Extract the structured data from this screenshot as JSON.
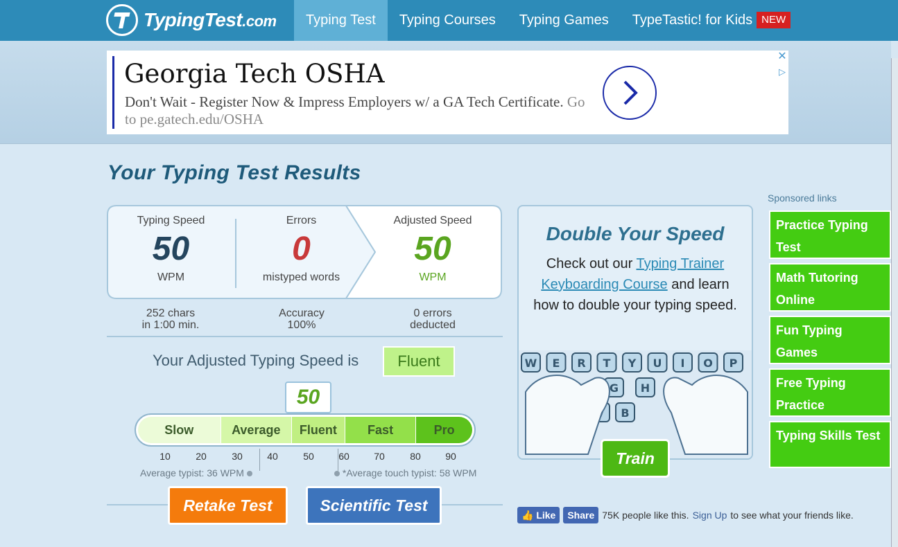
{
  "brand": {
    "name": "TypingTest",
    "tld": ".com"
  },
  "nav": {
    "items": [
      {
        "label": "Typing Test",
        "active": true
      },
      {
        "label": "Typing Courses",
        "active": false
      },
      {
        "label": "Typing Games",
        "active": false
      },
      {
        "label": "TypeTastic! for Kids",
        "active": false
      }
    ],
    "new_badge": "NEW"
  },
  "ad": {
    "title": "Georgia Tech OSHA",
    "body": "Don't Wait - Register Now & Impress Employers w/ a GA Tech Certificate.",
    "url": "Go to pe.gatech.edu/OSHA",
    "close": "✕",
    "info": "▷"
  },
  "results": {
    "title": "Your Typing Test Results",
    "speed": {
      "label": "Typing Speed",
      "value": "50",
      "unit": "WPM"
    },
    "errors": {
      "label": "Errors",
      "value": "0",
      "unit": "mistyped words"
    },
    "adjusted": {
      "label": "Adjusted Speed",
      "value": "50",
      "unit": "WPM"
    },
    "sub": {
      "chars_line1": "252 chars",
      "chars_line2": "in 1:00 min.",
      "accuracy_line1": "Accuracy",
      "accuracy_line2": "100%",
      "deduct_line1": "0 errors",
      "deduct_line2": "deducted"
    },
    "adjusted_text": "Your Adjusted Typing Speed is",
    "level": "Fluent",
    "marker_value": "50",
    "scale": [
      "Slow",
      "Average",
      "Fluent",
      "Fast",
      "Pro"
    ],
    "ticks": [
      "10",
      "20",
      "30",
      "40",
      "50",
      "60",
      "70",
      "80",
      "90"
    ],
    "avg_typist": "Average typist: 36 WPM",
    "avg_touch": "*Average touch typist: 58 WPM",
    "retake": "Retake Test",
    "scientific": "Scientific Test"
  },
  "promo": {
    "title": "Double Your Speed",
    "text_1": "Check out our",
    "link": "Typing Trainer Keyboarding Course",
    "text_2": "and learn how to double your typing speed.",
    "keys_row1": [
      "W",
      "E",
      "R",
      "T",
      "Y",
      "U",
      "I",
      "O",
      "P"
    ],
    "keys_row2": [
      "G",
      "H"
    ],
    "keys_row3": [
      "V",
      "B"
    ],
    "train": "Train"
  },
  "sponsored": {
    "label": "Sponsored links",
    "links": [
      "Practice Typing Test",
      "Math Tutoring Online",
      "Fun Typing Games",
      "Free Typing Practice",
      "Typing Skills Test"
    ]
  },
  "social": {
    "like": "Like",
    "share": "Share",
    "count_text": "75K people like this.",
    "signup": "Sign Up",
    "after": "to see what your friends like."
  },
  "colors": {
    "nav": "#2d8bb8",
    "nav_active": "#5fb0d6",
    "speed": "#24455e",
    "errors": "#c8393a",
    "adjusted": "#5aa520",
    "retake": "#f47b0c",
    "scientific": "#3d74bc",
    "sponsored": "#44cc12"
  }
}
